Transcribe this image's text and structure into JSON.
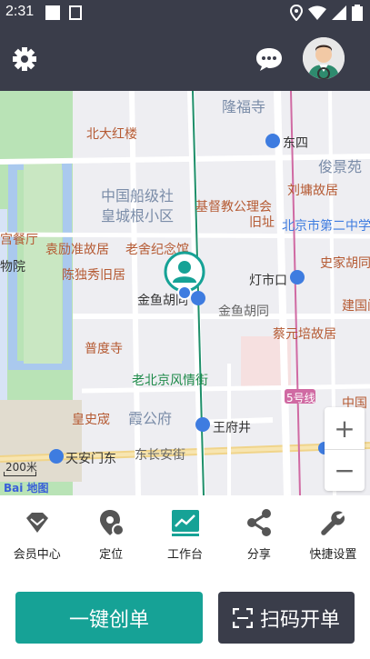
{
  "status_bar": {
    "time": "2:31"
  },
  "map": {
    "labels": {
      "longfu_temple": "隆福寺",
      "beidahongqiao": "北大红楼",
      "dongsi": "东四",
      "junjingyuan": "俊景苑",
      "chuanbo_community": "中国船级社",
      "huangchenggen": "皇城根小区",
      "liuyong_residence": "刘墉故居",
      "christian_hall": "基督教公理会",
      "old_site": "旧址",
      "beijing_no2_school": "北京市第二中学",
      "palace_restaurant": "宫餐厅",
      "yuanliang_residence": "袁励准故居",
      "laoshe_memorial": "老舍纪念馆",
      "shijia_hutong": "史家胡同",
      "museum_fragment": "物院",
      "chenduxiu_residence": "陈独秀旧居",
      "dengshikou": "灯市口",
      "jianguo_fragment": "建国门",
      "jinyu_hutong_station": "金鱼胡同",
      "jinyu_hutong": "金鱼胡同",
      "caiyuanpei_residence": "蔡元培故居",
      "pudu_temple": "普度寺",
      "old_beijing_street": "老北京风情街",
      "line5": "5号线",
      "china_fragment": "中国",
      "huangshicheng": "皇史宬",
      "xiagong_mansion": "霞公府",
      "wangfujing": "王府井",
      "tiananmen_east": "天安门东",
      "dongchanganjie": "东长安街"
    },
    "scale_text": "200米",
    "logo_text": "Bai 地图"
  },
  "zoom": {
    "plus": "+",
    "minus": "−"
  },
  "nav": {
    "items": [
      {
        "label": "会员中心"
      },
      {
        "label": "定位"
      },
      {
        "label": "工作台"
      },
      {
        "label": "分享"
      },
      {
        "label": "快捷设置"
      }
    ]
  },
  "actions": {
    "create_label": "一键创单",
    "scan_label": "扫码开单"
  },
  "colors": {
    "header_bg": "#3a3d4a",
    "accent": "#16a296"
  }
}
